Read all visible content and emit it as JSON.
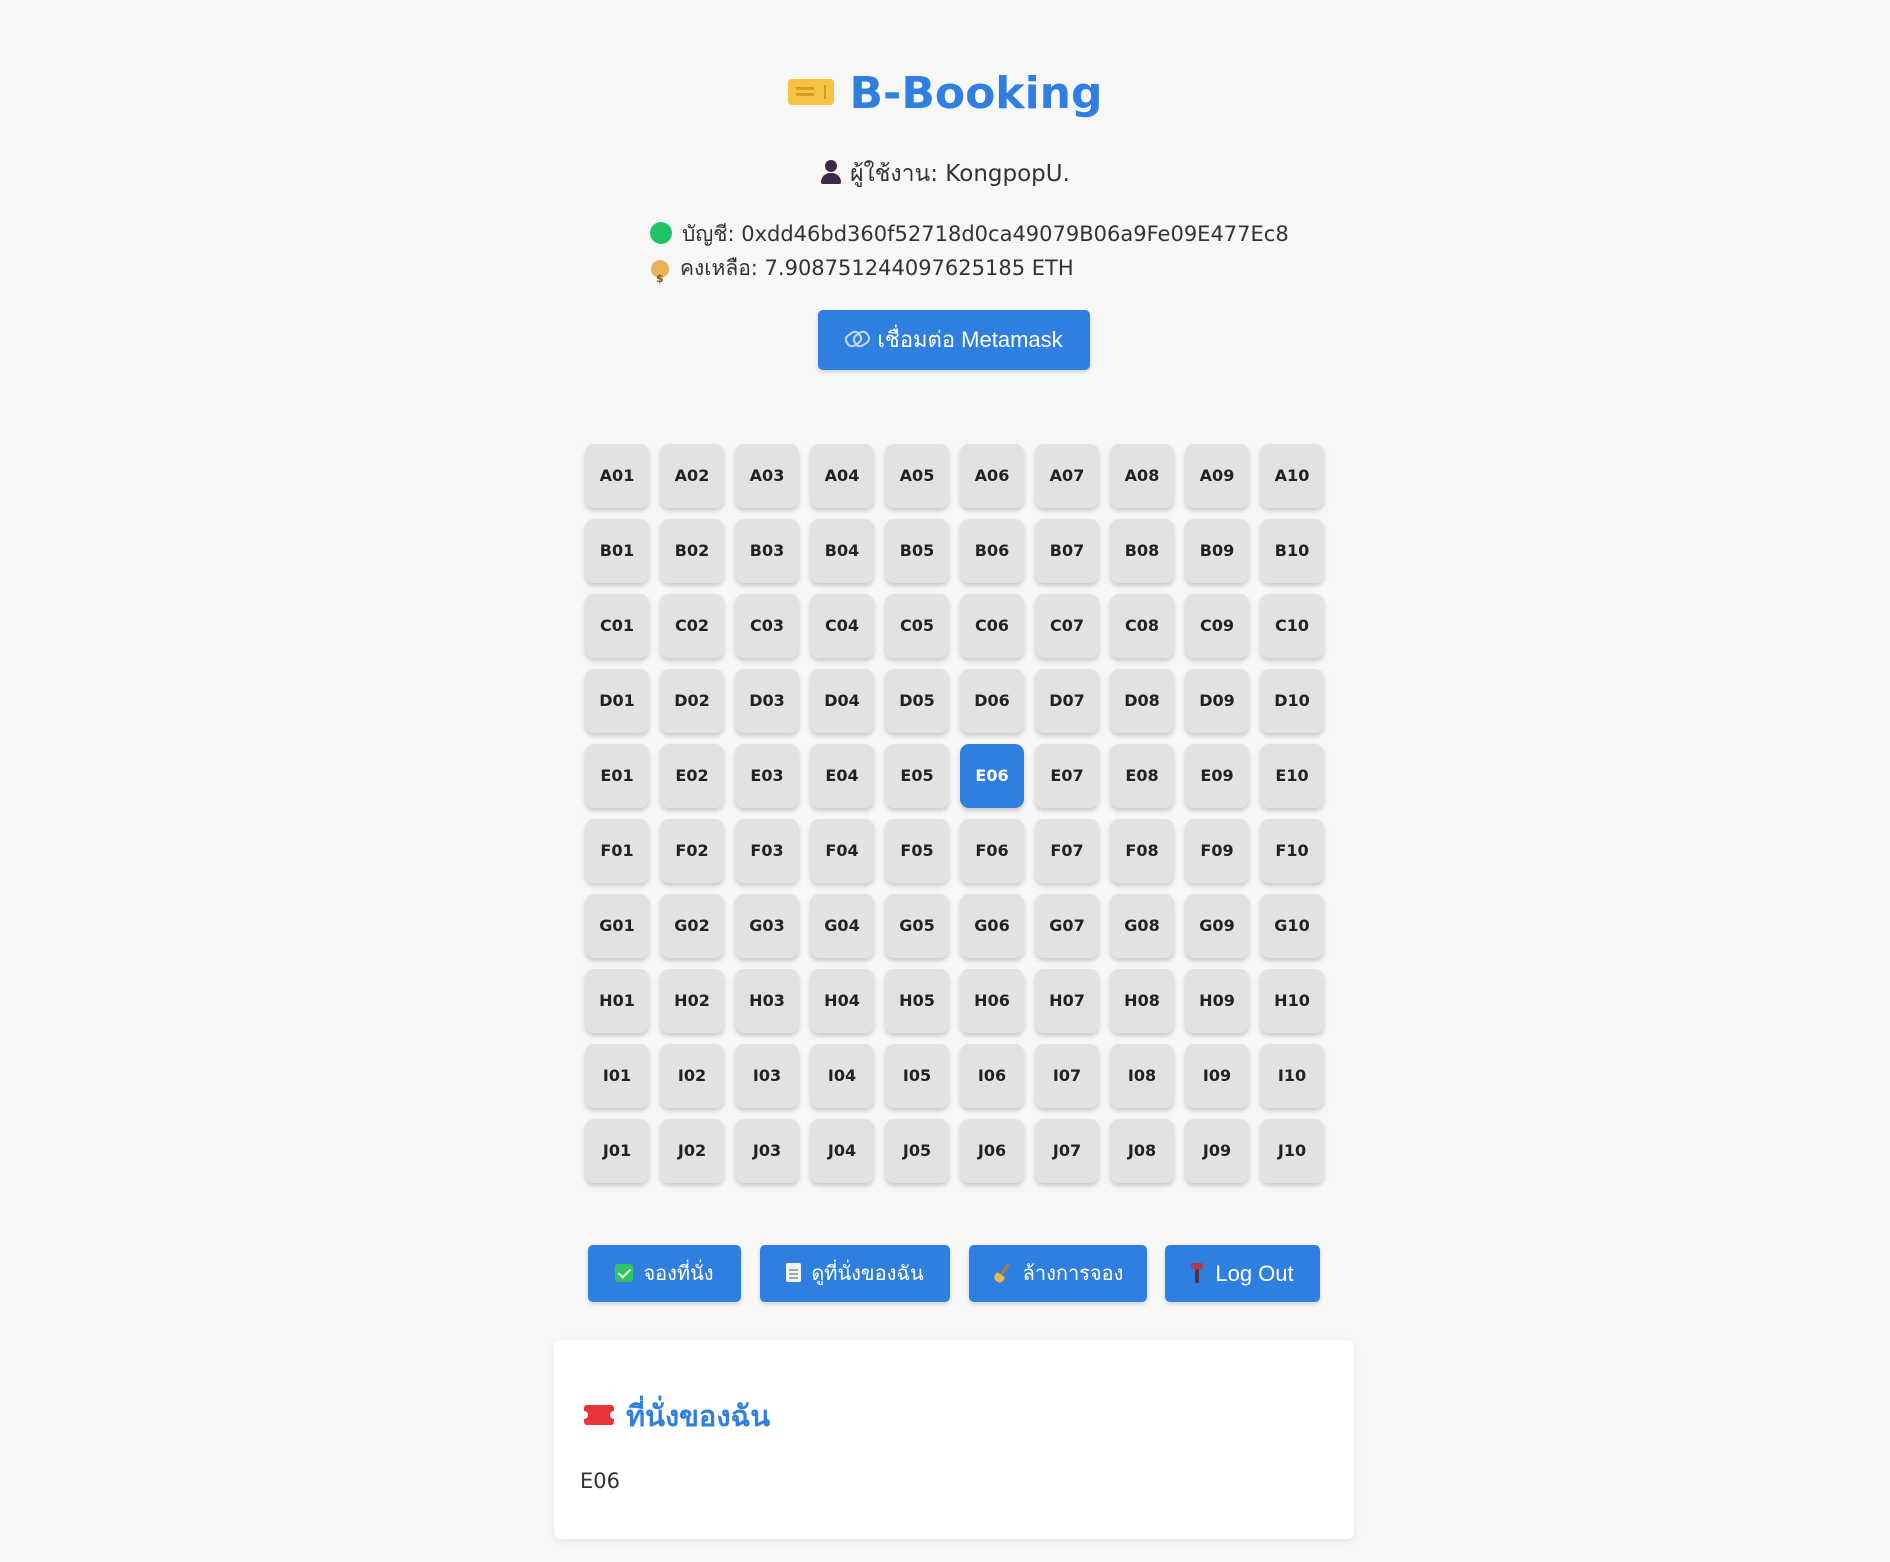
{
  "header": {
    "title": "B-Booking",
    "title_icon": "ticket-icon",
    "user_label": "ผู้ใช้งาน: KongpopU."
  },
  "account": {
    "address_label": "บัญชี: 0xdd46bd360f52718d0ca49079B06a9Fe09E477Ec8",
    "balance_label": "คงเหลือ: 7.908751244097625185 ETH",
    "status_color": "#1cc463"
  },
  "connect_button": {
    "label": "เชื่อมต่อ Metamask",
    "icon": "link-icon"
  },
  "seats": {
    "rows": [
      "A",
      "B",
      "C",
      "D",
      "E",
      "F",
      "G",
      "H",
      "I",
      "J"
    ],
    "columns": [
      "01",
      "02",
      "03",
      "04",
      "05",
      "06",
      "07",
      "08",
      "09",
      "10"
    ],
    "selected": [
      "E06"
    ],
    "colors": {
      "available": "#e2e2e2",
      "selected": "#2f7fe0"
    }
  },
  "actions": {
    "book_label": "จองที่นั่ง",
    "view_label": "ดูที่นั่งของฉัน",
    "clear_label": "ล้างการจอง",
    "logout_label": "Log Out"
  },
  "my_seats": {
    "title": "ที่นั่งของฉัน",
    "list": "E06"
  },
  "theme": {
    "accent": "#2f7fe0",
    "background": "#f7f7f7"
  }
}
